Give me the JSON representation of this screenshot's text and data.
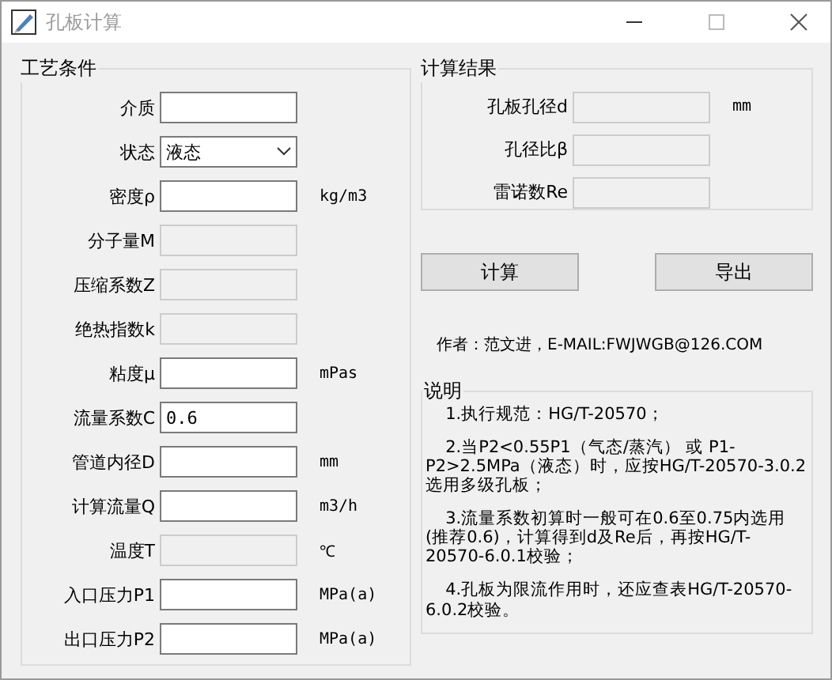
{
  "window": {
    "title": "孔板计算"
  },
  "process_conditions": {
    "title": "工艺条件",
    "fields": [
      {
        "label": "介质",
        "kind": "text",
        "disabled": false
      },
      {
        "label": "状态",
        "kind": "select",
        "value": "液态",
        "disabled": false
      },
      {
        "label": "密度ρ",
        "kind": "text",
        "disabled": false,
        "unit": "kg/m3"
      },
      {
        "label": "分子量M",
        "kind": "text",
        "disabled": true
      },
      {
        "label": "压缩系数Z",
        "kind": "text",
        "disabled": true
      },
      {
        "label": "绝热指数k",
        "kind": "text",
        "disabled": true
      },
      {
        "label": "粘度μ",
        "kind": "text",
        "disabled": false,
        "unit": "mPas"
      },
      {
        "label": "流量系数C",
        "kind": "text",
        "value": "0.6",
        "disabled": false
      },
      {
        "label": "管道内径D",
        "kind": "text",
        "disabled": false,
        "unit": "mm"
      },
      {
        "label": "计算流量Q",
        "kind": "text",
        "disabled": false,
        "unit": "m3/h"
      },
      {
        "label": "温度T",
        "kind": "text",
        "disabled": true,
        "unit": "℃"
      },
      {
        "label": "入口压力P1",
        "kind": "text",
        "disabled": false,
        "unit": "MPa(a)"
      },
      {
        "label": "出口压力P2",
        "kind": "text",
        "disabled": false,
        "unit": "MPa(a)"
      }
    ]
  },
  "results": {
    "title": "计算结果",
    "fields": [
      {
        "label": "孔板孔径d",
        "unit": "mm"
      },
      {
        "label": "孔径比β"
      },
      {
        "label": "雷诺数Re"
      }
    ]
  },
  "buttons": [
    "计算",
    "导出"
  ],
  "author": "作者：范文进，E-MAIL:FWJWGB@126.COM",
  "notes": {
    "title": "说明",
    "items": [
      "1.执行规范：HG/T-20570；",
      "2.当P2<0.55P1（气态/蒸汽） 或 P1-P2>2.5MPa（液态）时，应按HG/T-20570-3.0.2选用多级孔板；",
      "3.流量系数初算时一般可在0.6至0.75内选用(推荐0.6)，计算得到d及Re后，再按HG/T-20570-6.0.1校验；",
      "4.孔板为限流作用时，还应查表HG/T-20570-6.0.2校验。"
    ]
  }
}
